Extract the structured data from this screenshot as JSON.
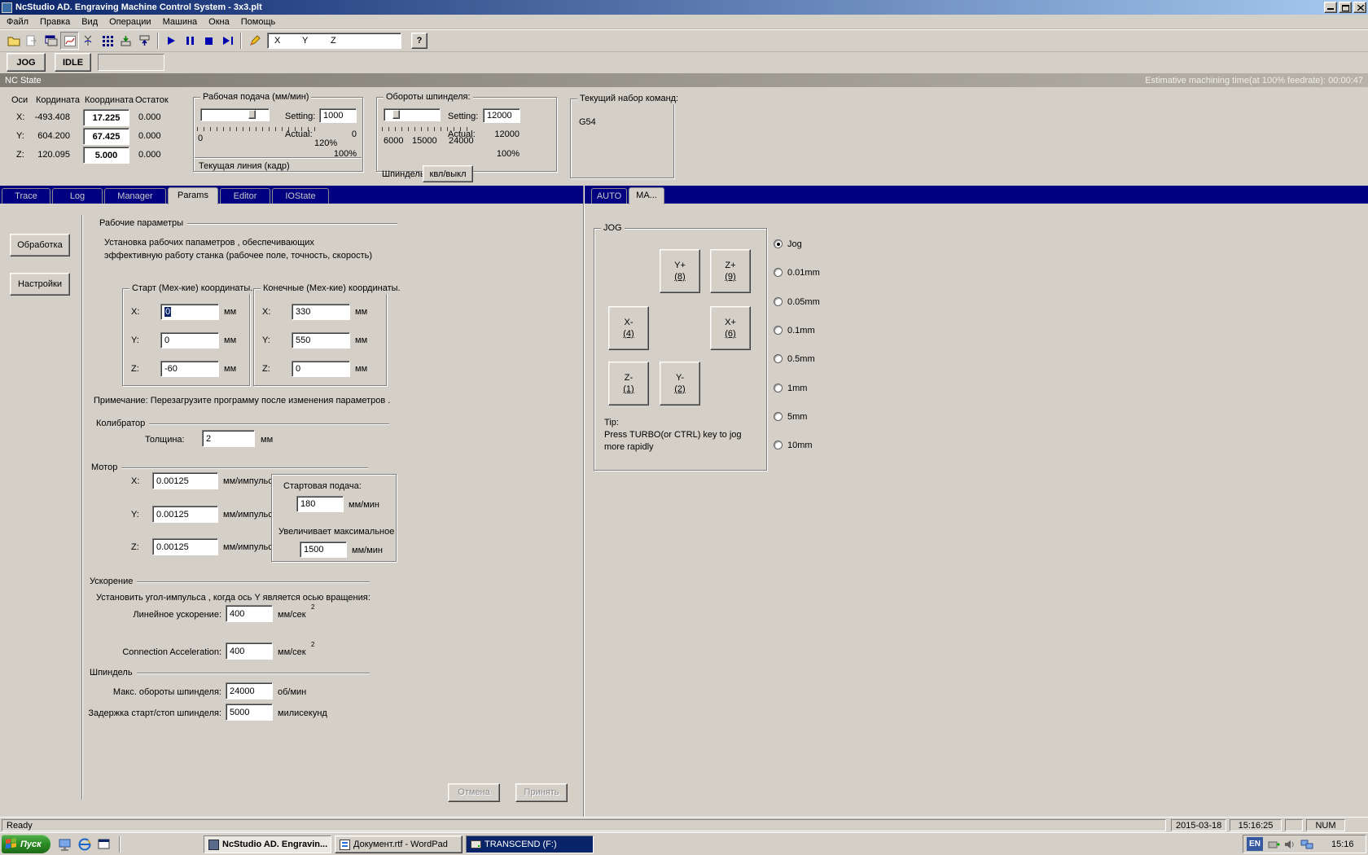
{
  "window": {
    "title": "NcStudio AD. Engraving Machine Control System - 3x3.plt"
  },
  "menubar": {
    "items": [
      "Файл",
      "Правка",
      "Вид",
      "Операции",
      "Машина",
      "Окна",
      "Помощь"
    ]
  },
  "toolbar": {
    "axes": [
      "X",
      "Y",
      "Z"
    ],
    "help": "?"
  },
  "icons": {
    "toolbar": [
      "open-file",
      "export",
      "simulate",
      "trace",
      "signal",
      "array",
      "load",
      "unload",
      "start",
      "pause",
      "stop",
      "single-step",
      "edit",
      "help"
    ],
    "window": [
      "app",
      "minimize",
      "maximize",
      "close"
    ],
    "taskbar": [
      "windows-logo",
      "desktop",
      "ie",
      "window",
      "ncstudio",
      "wordpad",
      "drive",
      "usb",
      "volume",
      "network"
    ]
  },
  "mode_row": {
    "jog": "JOG",
    "idle": "IDLE"
  },
  "nc_state": {
    "title": "NC State",
    "estimate": "Estimative machining time(at 100% feedrate): 00:00:47"
  },
  "coords": {
    "headers": {
      "axis": "Оси",
      "machine": "Кордината",
      "work": "Координата",
      "rest": "Остаток"
    },
    "rows": [
      {
        "axis": "X:",
        "machine": "-493.408",
        "work": "17.225",
        "rest": "0.000"
      },
      {
        "axis": "Y:",
        "machine": "604.200",
        "work": "67.425",
        "rest": "0.000"
      },
      {
        "axis": "Z:",
        "machine": "120.095",
        "work": "5.000",
        "rest": "0.000"
      }
    ]
  },
  "feed": {
    "title": "Рабочая подача (мм/мин)",
    "setting_label": "Setting:",
    "setting_value": "1000",
    "actual_label": "Actual:",
    "actual_value": "0",
    "scale_min": "0",
    "scale_max": "120%",
    "percent": "100%",
    "current_line_label": "Текущая линия (кадр)"
  },
  "spindle": {
    "title": "Обороты шпинделя:",
    "setting_label": "Setting:",
    "setting_value": "12000",
    "actual_label": "Actual:",
    "actual_value": "12000",
    "scale": [
      "6000",
      "15000",
      "24000"
    ],
    "percent": "100%",
    "name_label": "Шпиндель",
    "toggle_label": "квл/выкл"
  },
  "commands": {
    "title": "Текущий набор команд:",
    "value": "G54"
  },
  "left_tabs": [
    {
      "label": "Trace"
    },
    {
      "label": "Log"
    },
    {
      "label": "Manager"
    },
    {
      "label": "Params"
    },
    {
      "label": "Editor"
    },
    {
      "label": "IOState"
    }
  ],
  "right_tabs": [
    {
      "label": "AUTO"
    },
    {
      "label": "MA..."
    }
  ],
  "sidebar": {
    "processing": "Обработка",
    "settings": "Настройки"
  },
  "params": {
    "section_work": "Рабочие параметры",
    "desc1": "Установка рабочих папаметров , обеспечивающих",
    "desc2": "эффективную работу станка (рабочее поле, точность, скорость)",
    "start_legend": "Старт (Мех-кие) координаты.",
    "end_legend": "Конечные (Мех-кие) координаты.",
    "start": [
      {
        "axis": "X:",
        "value": "0",
        "unit": "мм"
      },
      {
        "axis": "Y:",
        "value": "0",
        "unit": "мм"
      },
      {
        "axis": "Z:",
        "value": "-60",
        "unit": "мм"
      }
    ],
    "end": [
      {
        "axis": "X:",
        "value": "330",
        "unit": "мм"
      },
      {
        "axis": "Y:",
        "value": "550",
        "unit": "мм"
      },
      {
        "axis": "Z:",
        "value": "0",
        "unit": "мм"
      }
    ],
    "note": "Примечание: Перезагрузите программу после  изменения  параметров .",
    "calibrator": "Колибратор",
    "thickness_label": "Толщина:",
    "thickness_value": "2",
    "thickness_unit": "мм",
    "motor": "Мотор",
    "motor_rows": [
      {
        "axis": "X:",
        "value": "0.00125",
        "unit": "мм/импульс"
      },
      {
        "axis": "Y:",
        "value": "0.00125",
        "unit": "мм/импульс"
      },
      {
        "axis": "Z:",
        "value": "0.00125",
        "unit": "мм/импульс"
      }
    ],
    "start_feed_label": "Стартовая подача:",
    "start_feed_value": "180",
    "start_feed_unit": "мм/мин",
    "max_feed_label": "Увеличивает максимальное",
    "max_feed_value": "1500",
    "max_feed_unit": "мм/мин",
    "accel": "Ускорение",
    "accel_note": "Установить угол-импульса , когда ось Y является осью вращения:",
    "linear_label": "Линейное ускорение:",
    "linear_value": "400",
    "conn_label": "Connection Acceleration:",
    "conn_value": "400",
    "accel_unit": "мм/сек",
    "accel_sup": "2",
    "spindle_section": "Шпиндель",
    "max_rpm_label": "Макс. обороты шпинделя:",
    "max_rpm_value": "24000",
    "max_rpm_unit": "об/мин",
    "delay_label": "Задержка старт/стоп шпинделя:",
    "delay_value": "5000",
    "delay_unit": "милисекунд",
    "cancel": "Отмена",
    "apply": "Принять"
  },
  "jog": {
    "legend": "JOG",
    "buttons": [
      {
        "label": "Y+",
        "key": "(8)"
      },
      {
        "label": "Z+",
        "key": "(9)"
      },
      {
        "label": "X-",
        "key": "(4)"
      },
      {
        "label": "X+",
        "key": "(6)"
      },
      {
        "label": "Z-",
        "key": "(1)"
      },
      {
        "label": "Y-",
        "key": "(2)"
      }
    ],
    "tip_title": "Tip:",
    "tip_line1": "Press TURBO(or CTRL) key to jog",
    "tip_line2": "more rapidly",
    "steps": [
      "Jog",
      "0.01mm",
      "0.05mm",
      "0.1mm",
      "0.5mm",
      "1mm",
      "5mm",
      "10mm"
    ]
  },
  "statusbar": {
    "ready": "Ready",
    "date": "2015-03-18",
    "time": "15:16:25",
    "num": "NUM"
  },
  "taskbar": {
    "start": "Пуск",
    "tasks": [
      {
        "label": "NcStudio AD. Engravin...",
        "state": "active"
      },
      {
        "label": "Документ.rtf - WordPad",
        "state": "normal"
      },
      {
        "label": "TRANSCEND (F:)",
        "state": "selected"
      }
    ],
    "lang": "EN",
    "clock": "15:16"
  },
  "colors": {
    "titlebar": "#0a246a",
    "tabstrip": "#000080",
    "selection": "#0a246a",
    "base": "#d4d0c8"
  }
}
